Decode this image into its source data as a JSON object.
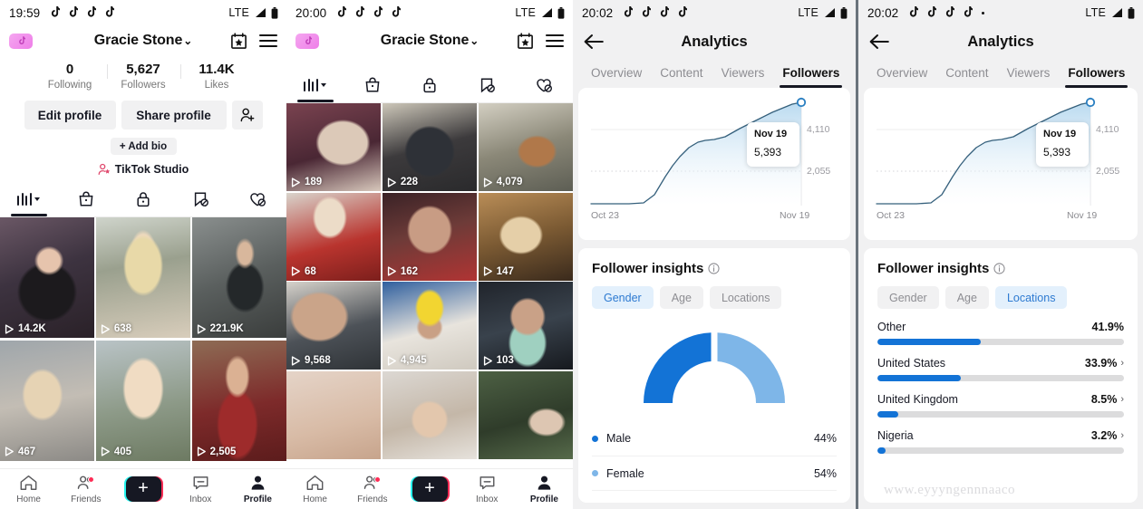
{
  "panels": {
    "profile1": {
      "status": {
        "time": "19:59",
        "network": "LTE",
        "note_count": 4
      },
      "header": {
        "name": "Gracie Stone",
        "chevron": "⌄"
      },
      "stats": [
        {
          "num": "0",
          "label": "Following"
        },
        {
          "num": "5,627",
          "label": "Followers"
        },
        {
          "num": "11.4K",
          "label": "Likes"
        }
      ],
      "buttons": {
        "edit": "Edit profile",
        "share": "Share profile",
        "add_bio": "+ Add bio",
        "studio": "TikTok Studio"
      },
      "tab_icons": [
        "grid-icon",
        "shopping-bag-icon",
        "lock-icon",
        "repost-slash-icon",
        "heart-slash-icon"
      ],
      "videos": [
        {
          "views": "14.2K"
        },
        {
          "views": "638"
        },
        {
          "views": "221.9K"
        },
        {
          "views": "467"
        },
        {
          "views": "405"
        },
        {
          "views": "2,505"
        }
      ],
      "nav": [
        {
          "label": "Home",
          "icon": "home-icon",
          "active": false
        },
        {
          "label": "Friends",
          "icon": "friends-icon",
          "active": false,
          "badge": true
        },
        {
          "label": "",
          "icon": "create-plus-icon",
          "active": false
        },
        {
          "label": "Inbox",
          "icon": "inbox-icon",
          "active": false
        },
        {
          "label": "Profile",
          "icon": "profile-icon",
          "active": true
        }
      ]
    },
    "profile2": {
      "status": {
        "time": "20:00",
        "network": "LTE",
        "note_count": 4
      },
      "header": {
        "name": "Gracie Stone",
        "chevron": "⌄"
      },
      "videos": [
        {
          "views": "189"
        },
        {
          "views": "228"
        },
        {
          "views": "4,079"
        },
        {
          "views": "68"
        },
        {
          "views": "162"
        },
        {
          "views": "147"
        },
        {
          "views": "9,568"
        },
        {
          "views": "4,945"
        },
        {
          "views": "103"
        }
      ],
      "nav": [
        {
          "label": "Home"
        },
        {
          "label": "Friends"
        },
        {
          "label": ""
        },
        {
          "label": "Inbox"
        },
        {
          "label": "Profile"
        }
      ]
    },
    "analytics_gender": {
      "status": {
        "time": "20:02",
        "network": "LTE",
        "note_count": 4
      },
      "title": "Analytics",
      "tabs": [
        {
          "label": "Overview",
          "active": false
        },
        {
          "label": "Content",
          "active": false
        },
        {
          "label": "Viewers",
          "active": false
        },
        {
          "label": "Followers",
          "active": true
        }
      ],
      "insights_title": "Follower insights",
      "pills": [
        {
          "label": "Gender",
          "active": true
        },
        {
          "label": "Age",
          "active": false
        },
        {
          "label": "Locations",
          "active": false
        }
      ],
      "gender_rows": [
        {
          "name": "Male",
          "value": "44%",
          "color": "#1373d6"
        },
        {
          "name": "Female",
          "value": "54%",
          "color": "#7eb6e8"
        }
      ]
    },
    "analytics_locations": {
      "status": {
        "time": "20:02",
        "network": "LTE",
        "note_count": 4,
        "extra_dot": true
      },
      "title": "Analytics",
      "tabs": [
        {
          "label": "Overview",
          "active": false
        },
        {
          "label": "Content",
          "active": false
        },
        {
          "label": "Viewers",
          "active": false
        },
        {
          "label": "Followers",
          "active": true
        }
      ],
      "insights_title": "Follower insights",
      "pills": [
        {
          "label": "Gender",
          "active": false
        },
        {
          "label": "Age",
          "active": false
        },
        {
          "label": "Locations",
          "active": true
        }
      ],
      "locations": [
        {
          "name": "Other",
          "value": "41.9%",
          "pct": 41.9,
          "chevron": ""
        },
        {
          "name": "United States",
          "value": "33.9%",
          "pct": 33.9,
          "chevron": "›"
        },
        {
          "name": "United Kingdom",
          "value": "8.5%",
          "pct": 8.5,
          "chevron": "›"
        },
        {
          "name": "Nigeria",
          "value": "3.2%",
          "pct": 3.2,
          "chevron": "›"
        }
      ],
      "watermark": "www.eyyyngennnaaco"
    }
  },
  "chart_data": {
    "type": "area",
    "title": "Follower growth",
    "xlabel": "",
    "ylabel": "",
    "x_ticks": [
      "Oct 23",
      "Nov 19"
    ],
    "y_ticks": [
      "2,055",
      "4,110"
    ],
    "ylim": [
      0,
      6165
    ],
    "grid": true,
    "legend": "none",
    "annotation": {
      "date": "Nov 19",
      "value": "5,393"
    },
    "series": [
      {
        "name": "Followers",
        "line_color": "#2b5f7a",
        "fill_from": "#bcdcf0",
        "fill_to": "#ffffff",
        "x": [
          "Oct 23",
          "Oct 25",
          "Oct 27",
          "Oct 29",
          "Oct 31",
          "Nov 2",
          "Nov 4",
          "Nov 5",
          "Nov 6",
          "Nov 7",
          "Nov 8",
          "Nov 9",
          "Nov 10",
          "Nov 11",
          "Nov 12",
          "Nov 13",
          "Nov 15",
          "Nov 17",
          "Nov 19"
        ],
        "values": [
          40,
          40,
          40,
          40,
          40,
          45,
          420,
          1200,
          1700,
          2100,
          2600,
          3050,
          3400,
          3450,
          3500,
          3700,
          4200,
          4850,
          5393
        ]
      }
    ]
  }
}
